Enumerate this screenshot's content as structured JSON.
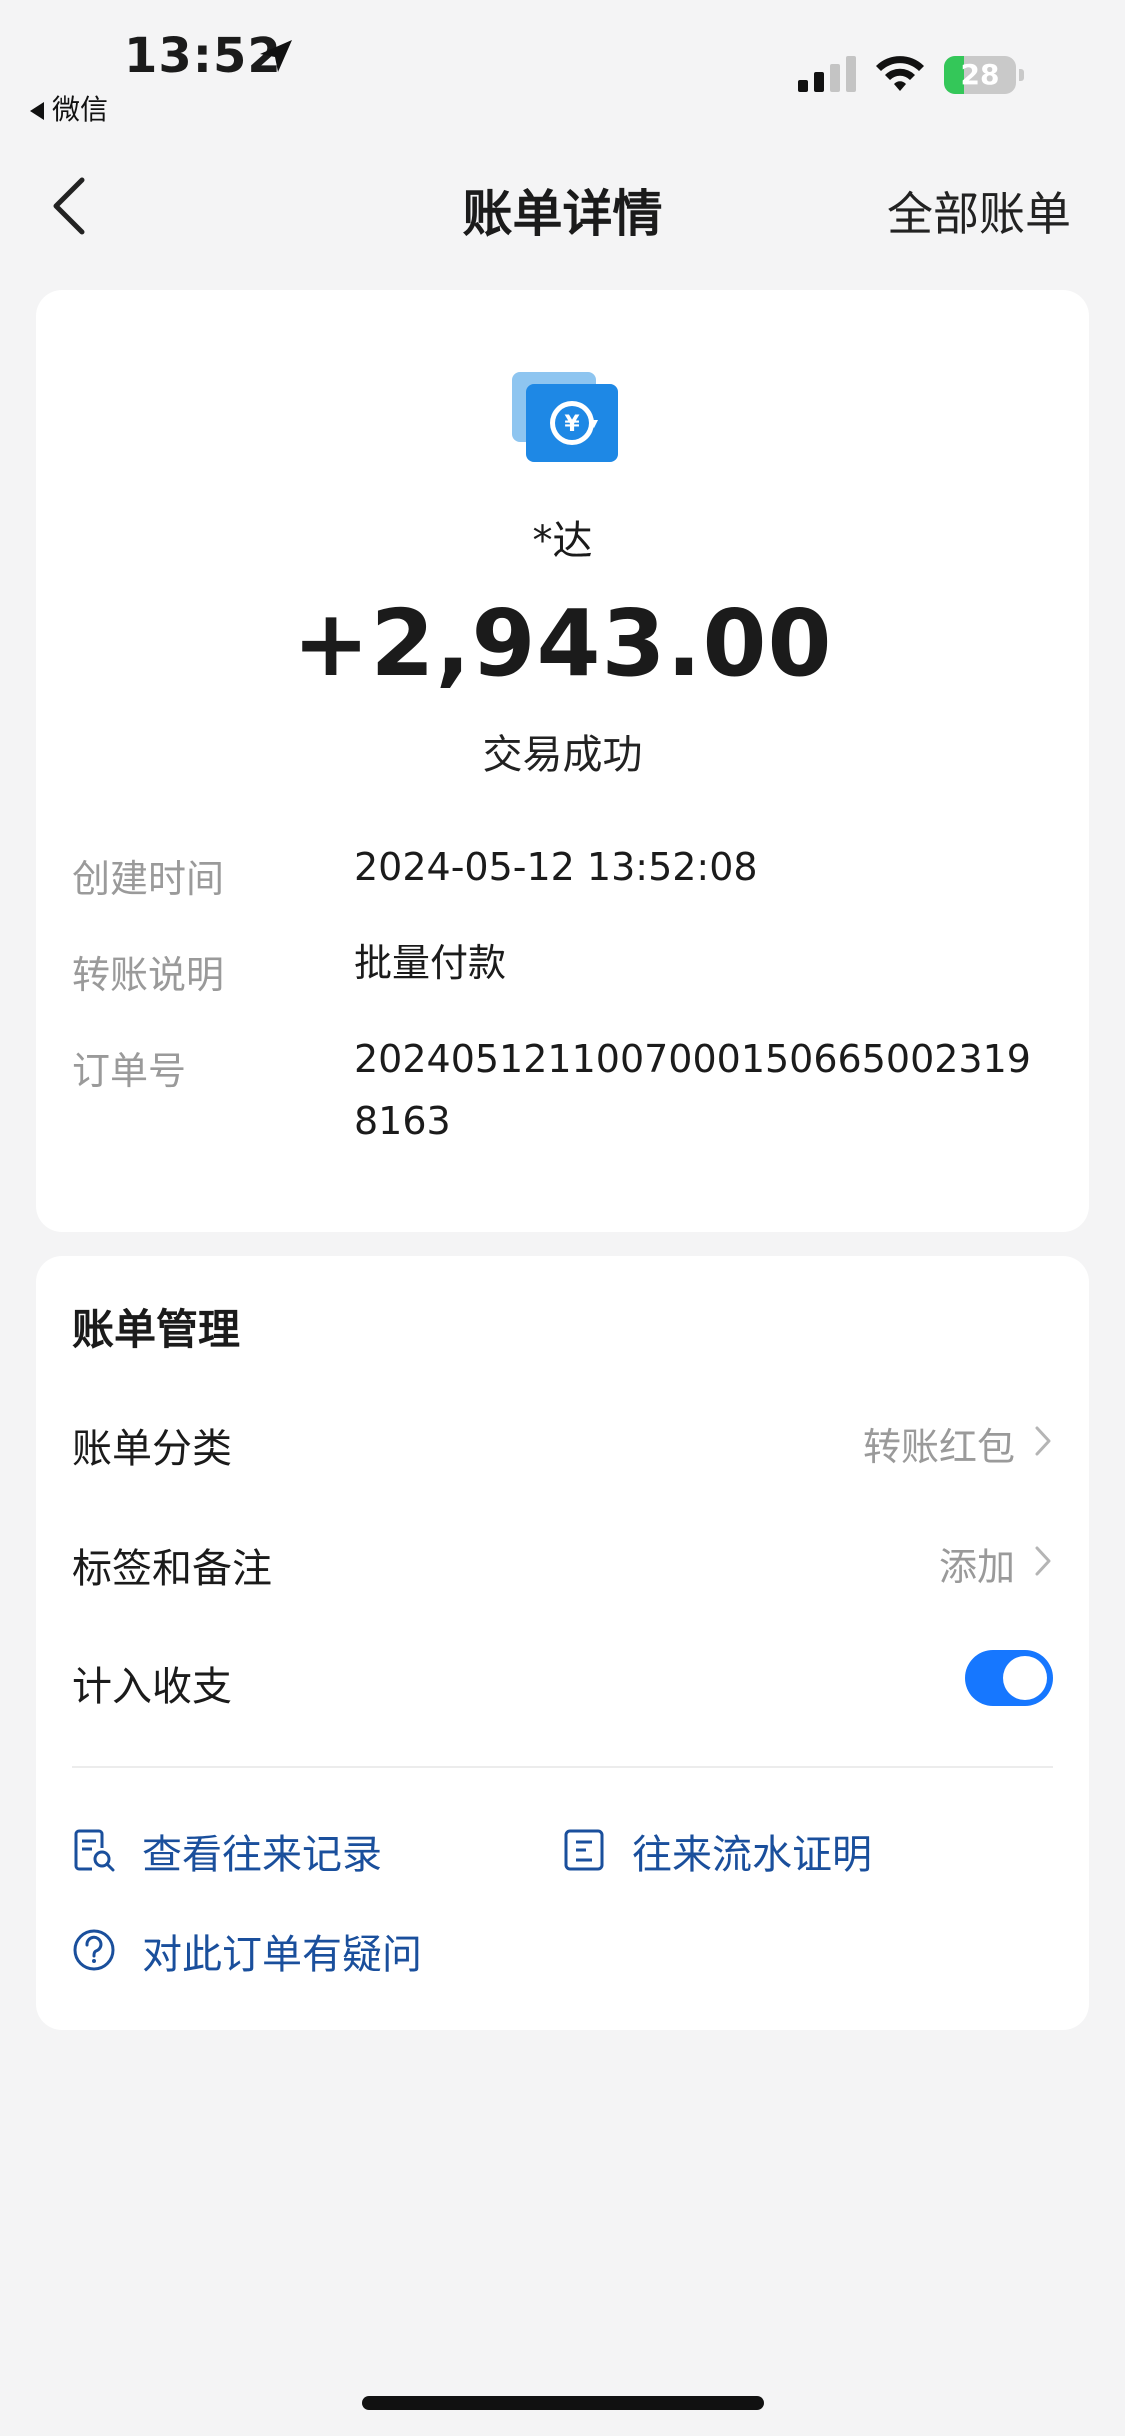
{
  "status_bar": {
    "time": "13:52",
    "back_app_label": "微信",
    "battery_level": "28",
    "battery_percent": 28,
    "battery_color": "#34c759"
  },
  "nav": {
    "back_icon": "chevron-left-icon",
    "title": "账单详情",
    "right_link": "全部账单"
  },
  "transaction": {
    "icon": "transfer-yuan-icon",
    "payee": "*达",
    "amount": "+2,943.00",
    "status": "交易成功",
    "details": [
      {
        "label": "创建时间",
        "value": "2024-05-12 13:52:08"
      },
      {
        "label": "转账说明",
        "value": "批量付款"
      },
      {
        "label": "订单号",
        "value": "20240512110070001506650023198163"
      }
    ]
  },
  "management": {
    "title": "账单管理",
    "category_label": "账单分类",
    "category_value": "转账红包",
    "tags_label": "标签和备注",
    "tags_value": "添加",
    "include_label": "计入收支",
    "include_enabled": true,
    "links": {
      "records": "查看往来记录",
      "proof": "往来流水证明",
      "question": "对此订单有疑问"
    }
  },
  "colors": {
    "accent": "#1677ff",
    "link": "#1a4f9c",
    "background": "#f4f4f5"
  }
}
